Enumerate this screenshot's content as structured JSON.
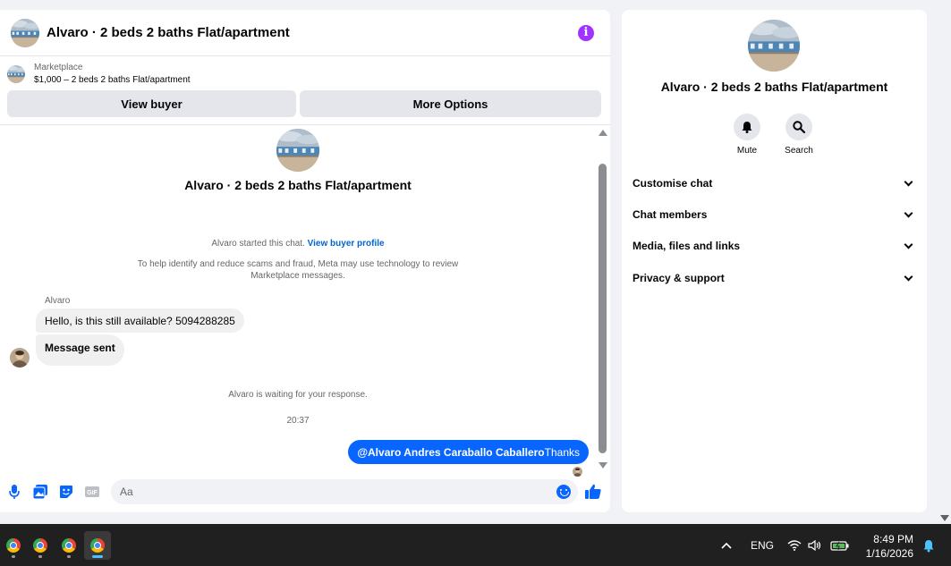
{
  "chat": {
    "title": "Alvaro · 2 beds 2 baths Flat/apartment",
    "info_icon": "info-icon",
    "listing_label": "Marketplace",
    "listing_value": "$1,000 – 2 beds 2 baths Flat/apartment",
    "view_buyer": "View buyer",
    "more_options": "More Options",
    "hero_title": "Alvaro · 2 beds 2 baths Flat/apartment",
    "started_text": "Alvaro started this chat.",
    "view_buyer_profile": "View buyer profile",
    "scam_notice_1": "To help identify and reduce scams and fraud, Meta may use technology to review",
    "scam_notice_2": "Marketplace messages.",
    "sender": "Alvaro",
    "msg1": "Hello, is this still available? 5094288285",
    "msg2": "Message sent",
    "waiting": "Alvaro is waiting for your response.",
    "time": "20:37",
    "out_mention": "@Alvaro Andres Caraballo Caballero",
    "out_text": "Thanks",
    "input_placeholder": "Aa"
  },
  "side": {
    "title": "Alvaro · 2 beds 2 baths Flat/apartment",
    "mute": "Mute",
    "search": "Search",
    "sections": [
      "Customise chat",
      "Chat members",
      "Media, files and links",
      "Privacy & support"
    ]
  },
  "taskbar": {
    "lang": "ENG",
    "time": "8:49 PM",
    "date": "1/16/2026"
  },
  "colors": {
    "accent": "#0866ff",
    "info": "#a033ff"
  }
}
